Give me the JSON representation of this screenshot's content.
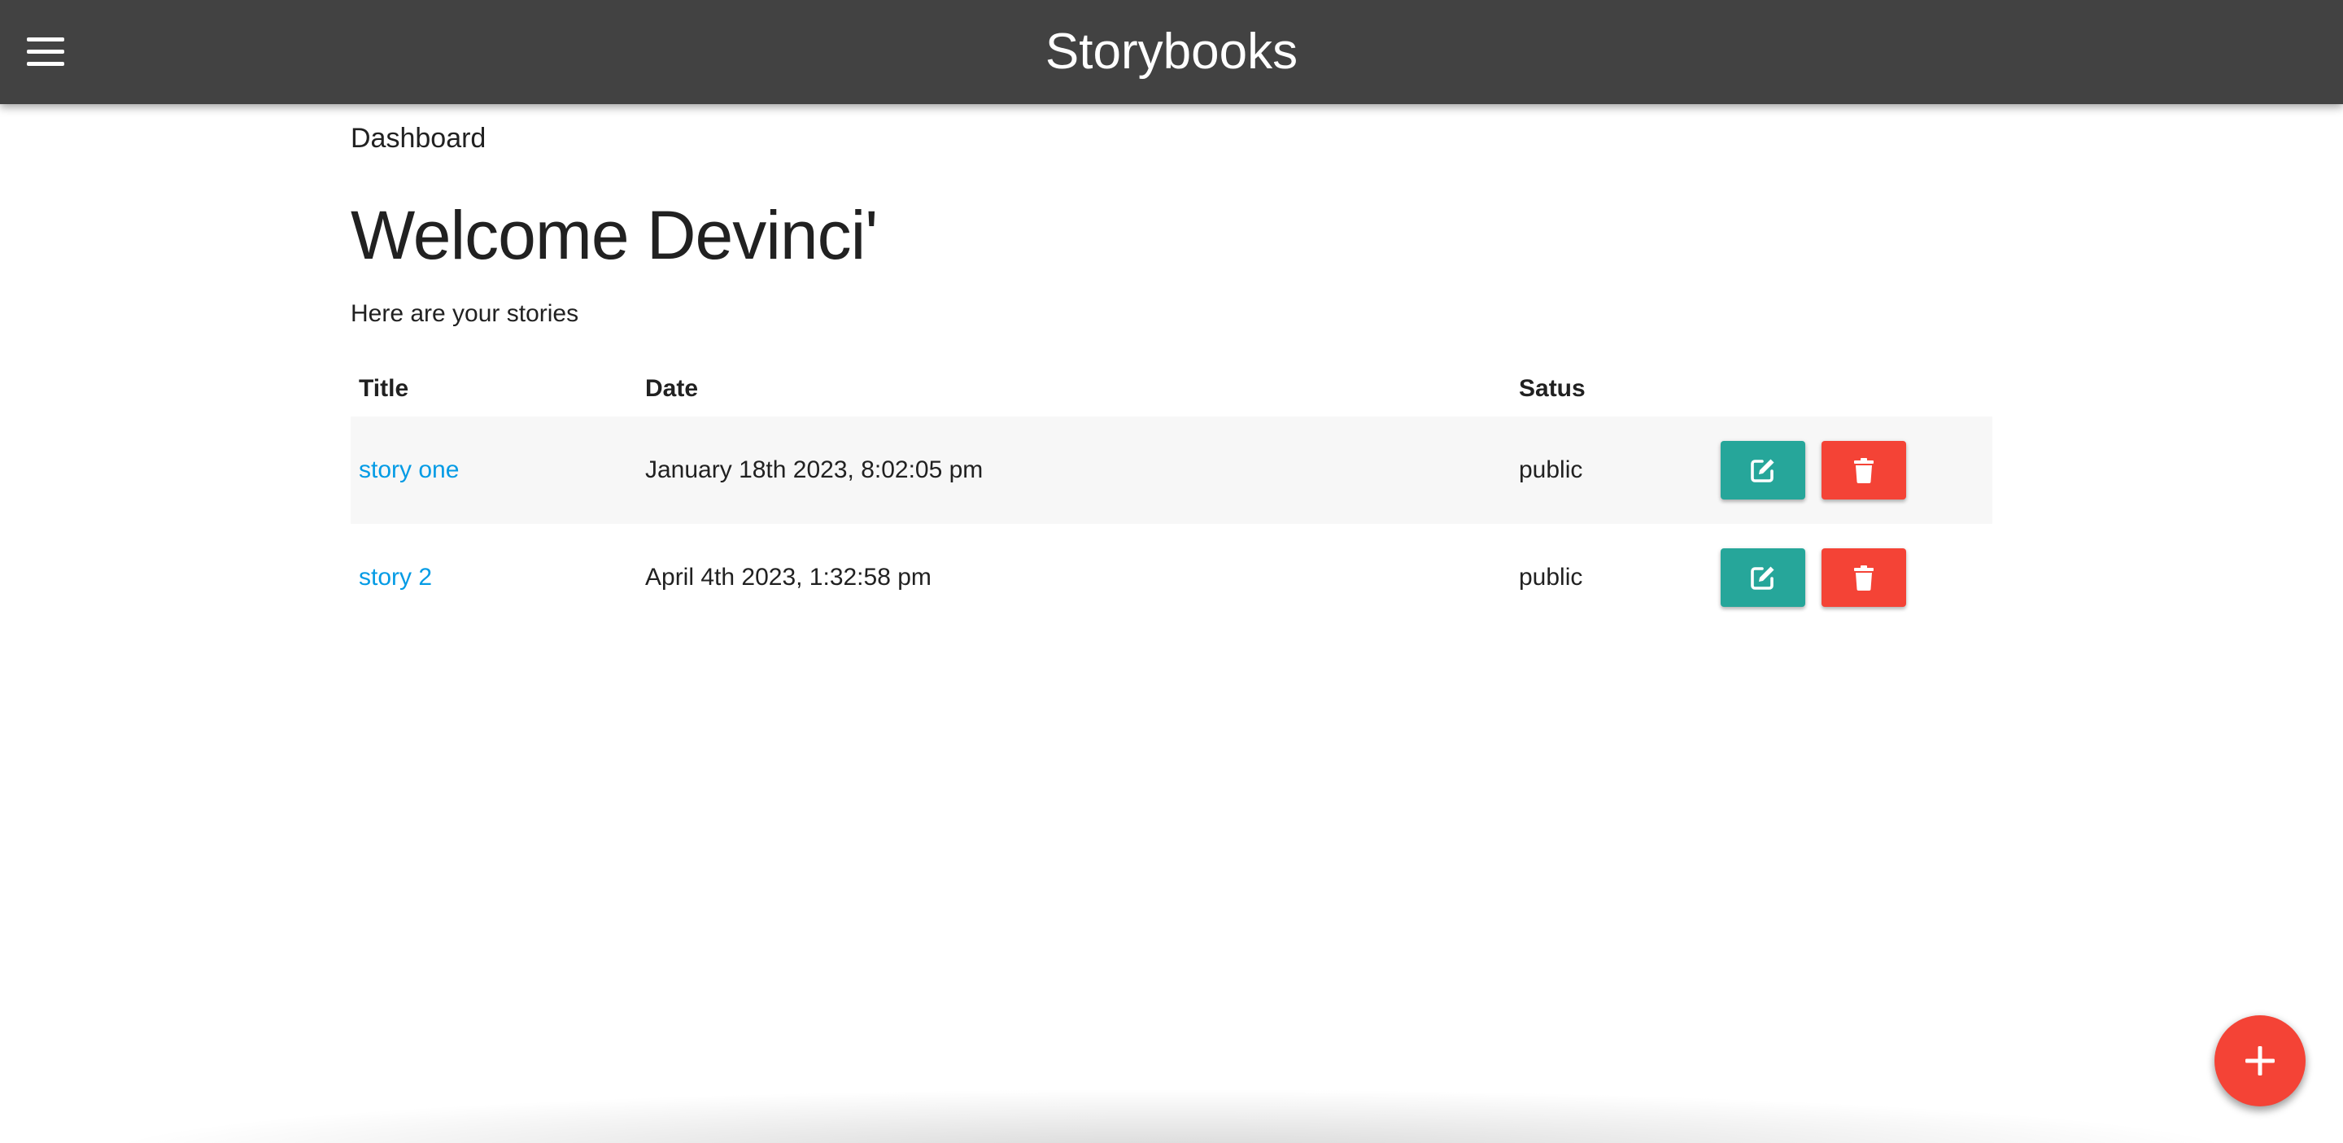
{
  "navbar": {
    "brand": "Storybooks",
    "menu_icon": "hamburger-menu-icon"
  },
  "main": {
    "breadcrumb": "Dashboard",
    "welcome": "Welcome Devinci'",
    "subtitle": "Here are your stories"
  },
  "table": {
    "headers": {
      "title": "Title",
      "date": "Date",
      "status": "Satus"
    },
    "rows": [
      {
        "title": "story one",
        "date": "January 18th 2023, 8:02:05 pm",
        "status": "public",
        "edit_icon": "edit-icon",
        "delete_icon": "trash-icon"
      },
      {
        "title": "story 2",
        "date": "April 4th 2023, 1:32:58 pm",
        "status": "public",
        "edit_icon": "edit-icon",
        "delete_icon": "trash-icon"
      }
    ]
  },
  "fab": {
    "icon": "plus-icon"
  },
  "colors": {
    "navbar": "#424242",
    "link": "#039be5",
    "edit_button": "#26a69a",
    "delete_button": "#f44336",
    "fab": "#f44336"
  }
}
